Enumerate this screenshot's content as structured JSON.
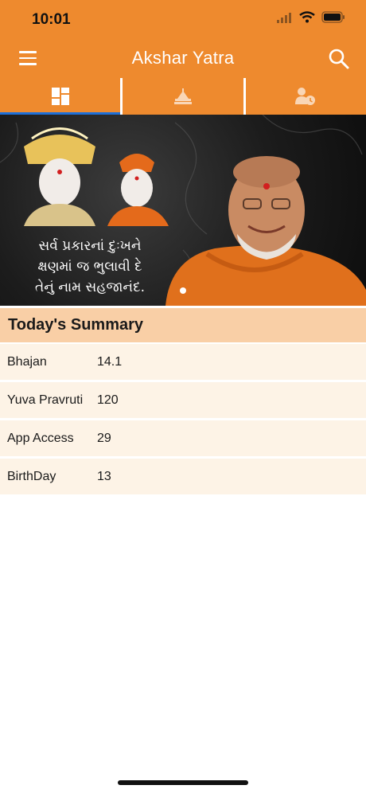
{
  "status_bar": {
    "time": "10:01",
    "icons": [
      "signal-icon",
      "wifi-icon",
      "battery-icon"
    ]
  },
  "nav": {
    "title": "Akshar Yatra",
    "left_icon": "menu-icon",
    "right_icon": "search-icon"
  },
  "tabs": [
    {
      "icon": "dashboard-icon",
      "active": true
    },
    {
      "icon": "mandir-icon",
      "active": false
    },
    {
      "icon": "user-clock-icon",
      "active": false
    }
  ],
  "banner": {
    "lines": [
      "સર્વ પ્રકારનાં દુઃખને",
      "ક્ષણમાં જ ભુલાવી દે",
      "તેનું નામ સહજાનંદ."
    ],
    "page_indicator": {
      "current": 1,
      "total": 1
    }
  },
  "summary": {
    "title": "Today's Summary",
    "rows": [
      {
        "label": "Bhajan",
        "value": "14.1"
      },
      {
        "label": "Yuva Pravruti",
        "value": "120"
      },
      {
        "label": "App Access",
        "value": "29"
      },
      {
        "label": "BirthDay",
        "value": "13"
      }
    ]
  },
  "colors": {
    "primary": "#ee8a2e",
    "tab_indicator": "#1d6fd8",
    "summary_header": "#f9cfa6",
    "row_background": "#fdf3e6"
  }
}
